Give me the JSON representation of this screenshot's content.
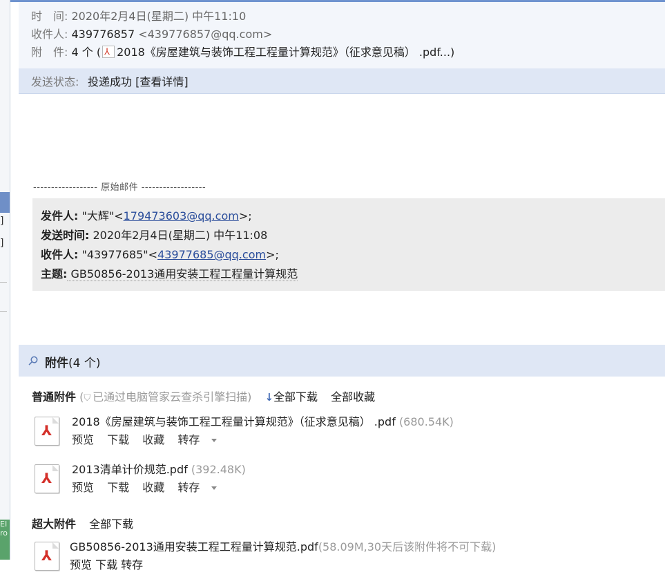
{
  "header": {
    "time_label": "时　间:",
    "time_value": "2020年2月4日(星期二) 中午11:10",
    "to_label": "收件人:",
    "to_name": "439776857",
    "to_email": "<439776857@qq.com>",
    "att_label": "附　件:",
    "att_count": "4 个 (",
    "att_first_name": "2018《房屋建筑与装饰工程工程量计算规范》（征求意见稿）  .pdf...)"
  },
  "status": {
    "label": "发送状态:",
    "value": "投递成功 [查看详情]"
  },
  "original": {
    "separator": "------------------ 原始邮件 ------------------",
    "from_label": "发件人:",
    "from_name": " \"大辉\"<",
    "from_email": "179473603@qq.com",
    "from_tail": ">;",
    "sent_label": "发送时间:",
    "sent_value": " 2020年2月4日(星期二) 中午11:08",
    "to_label": "收件人:",
    "to_name": " \"43977685\"<",
    "to_email": "43977685@qq.com",
    "to_tail": ">;",
    "subject_label": "主题:",
    "subject_value": " GB50856-2013通用安装工程工程量计算规范"
  },
  "attachments": {
    "title": "附件",
    "count": "(4 个)",
    "normal": {
      "label": "普通附件",
      "scan_note": "已通过电脑管家云查杀引擎扫描)",
      "scan_open": "(",
      "download_all": "全部下载",
      "save_all": "全部收藏"
    },
    "files": [
      {
        "name": "2018《房屋建筑与装饰工程工程量计算规范》（征求意见稿） .pdf",
        "size": "(680.54K)"
      },
      {
        "name": "2013清单计价规范.pdf",
        "size": "(392.48K)"
      }
    ],
    "ops": {
      "preview": "预览",
      "download": "下载",
      "favorite": "收藏",
      "transfer": "转存"
    },
    "large": {
      "label": "超大附件",
      "download_all": "全部下载",
      "file_name": "GB50856-2013通用安装工程工程量计算规范.pdf",
      "file_size": "(58.09M,30天后该附件将不可下载)",
      "ops_partial": "预览  下载  转存"
    }
  },
  "icons": [
    "pdf-icon",
    "paperclip-icon",
    "shield-icon",
    "download-arrow-icon",
    "caret-down-icon"
  ],
  "colors": {
    "accent": "#6f93cf",
    "header_bg": "#f3f6fb",
    "bar_bg": "#dfe7f5",
    "link": "#2a4d9b",
    "pdf_red": "#d4302a"
  }
}
